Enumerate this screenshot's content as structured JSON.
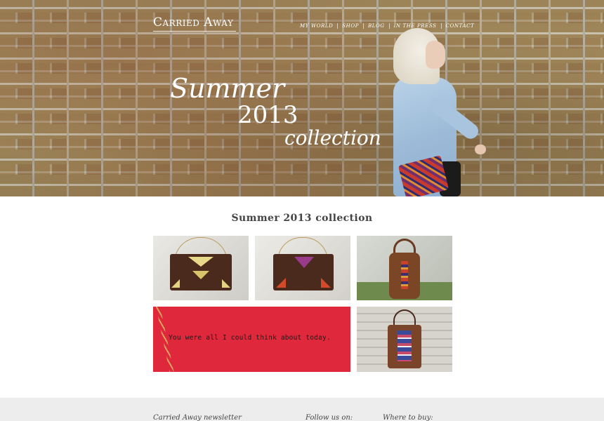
{
  "brand": {
    "logo_text": "Carried Away"
  },
  "nav": {
    "items": [
      "My world",
      "Shop",
      "Blog",
      "In the press",
      "Contact"
    ]
  },
  "hero": {
    "line1": "Summer",
    "line2": "2013",
    "line3": "collection"
  },
  "section": {
    "title": "Summer 2013 collection"
  },
  "gallery": {
    "quote_text": "You were all I could think about today."
  },
  "footer": {
    "newsletter_label": "Carried Away newsletter",
    "follow_label": "Follow us on:",
    "where_label": "Where to buy:"
  },
  "colors": {
    "accent_red": "#e0283c",
    "footer_bg": "#ededed",
    "leather_brown": "#4a2a1d"
  }
}
